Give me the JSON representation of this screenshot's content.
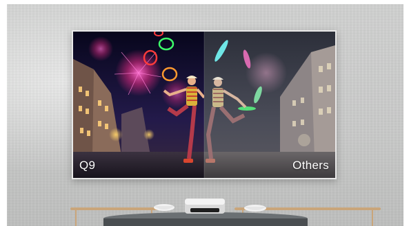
{
  "screen": {
    "left_label": "Q9",
    "right_label": "Others"
  },
  "colors": {
    "wall": "#c9cac9",
    "screen_frame": "#e9e9e9",
    "left_sky": "#0c0a2a",
    "right_sky": "#3a3d4a",
    "firework_pink": "#ff3fa5",
    "hoop_green": "#3dff6a",
    "hoop_red": "#ff3b3b",
    "hoop_orange": "#ff9a2f"
  },
  "icons": [
    "firework",
    "juggling-pin",
    "hoop",
    "projector",
    "table",
    "bowl"
  ]
}
